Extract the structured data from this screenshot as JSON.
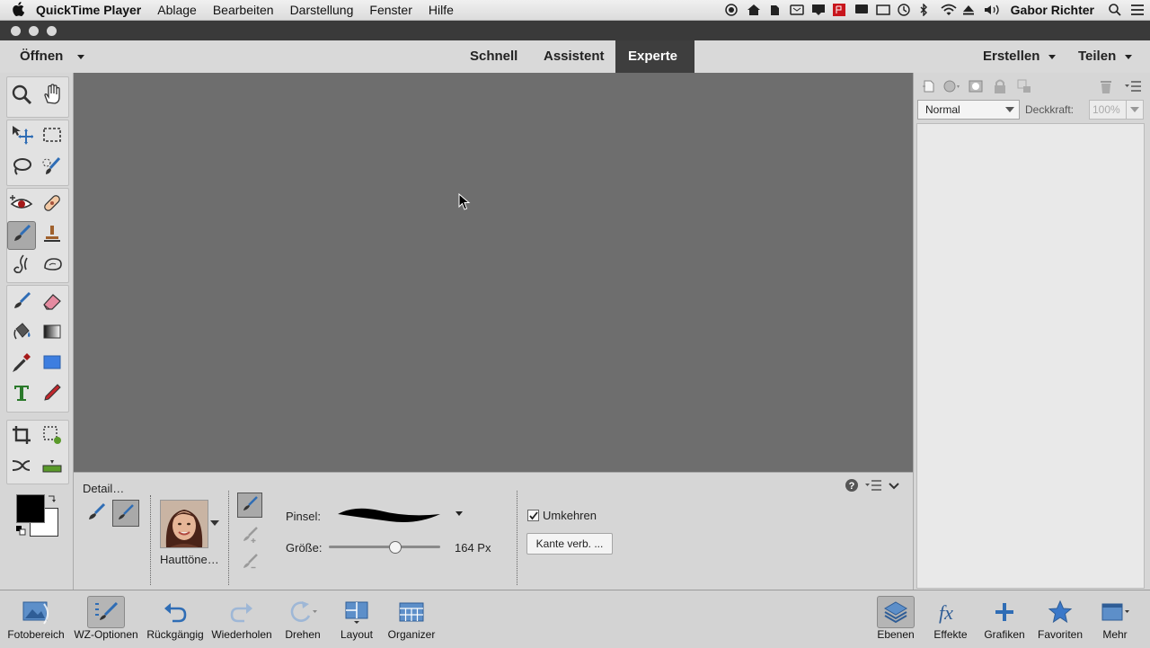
{
  "menubar": {
    "app_name": "QuickTime Player",
    "items": [
      "Ablage",
      "Bearbeiten",
      "Darstellung",
      "Fenster",
      "Hilfe"
    ],
    "user": "Gabor Richter"
  },
  "modes": {
    "open_label": "Öffnen",
    "tabs": [
      {
        "label": "Schnell"
      },
      {
        "label": "Assistent"
      },
      {
        "label": "Experte",
        "active": true
      }
    ],
    "create_label": "Erstellen",
    "share_label": "Teilen"
  },
  "layers_panel": {
    "blend_mode": "Normal",
    "opacity_label": "Deckkraft:",
    "opacity_value": "100%"
  },
  "options": {
    "title": "Detail…",
    "preset_label": "Hauttöne…",
    "brush_label": "Pinsel:",
    "size_label": "Größe:",
    "size_value": "164 Px",
    "size_fraction": 0.6,
    "invert_label": "Umkehren",
    "invert_checked": true,
    "refine_edge_label": "Kante verb. ..."
  },
  "bottombar": {
    "photo_bin": "Fotobereich",
    "tool_options": "WZ-Optionen",
    "undo": "Rückgängig",
    "redo": "Wiederholen",
    "rotate": "Drehen",
    "layout": "Layout",
    "organizer": "Organizer",
    "layers": "Ebenen",
    "effects": "Effekte",
    "graphics": "Grafiken",
    "favorites": "Favoriten",
    "more": "Mehr"
  },
  "colors": {
    "foreground": "#000000",
    "background": "#ffffff",
    "accent_blue": "#2f6db5"
  }
}
